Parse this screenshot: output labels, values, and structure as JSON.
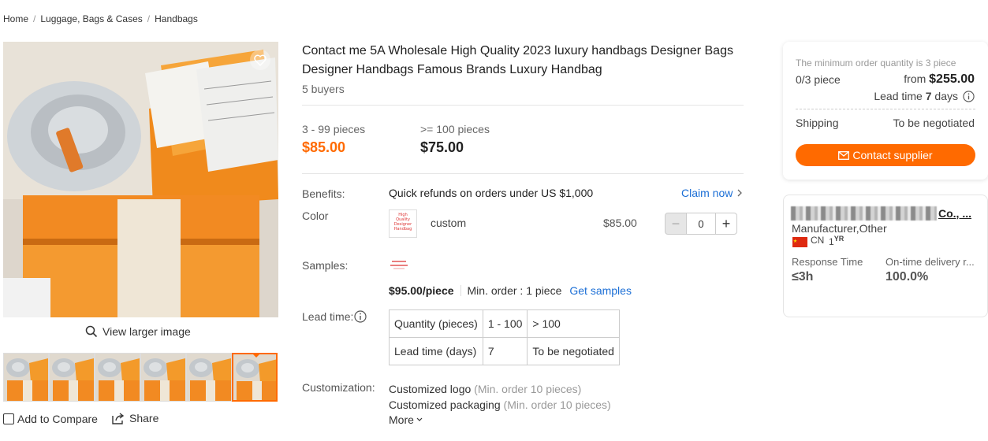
{
  "breadcrumb": {
    "items": [
      "Home",
      "Luggage, Bags & Cases",
      "Handbags"
    ],
    "separator": "/"
  },
  "gallery": {
    "view_larger": "View larger image",
    "thumb_count": 6,
    "active_thumb": 6,
    "add_to_compare": "Add to Compare",
    "share": "Share"
  },
  "product": {
    "title": "Contact me 5A Wholesale High Quality 2023 luxury handbags Designer Bags Designer Handbags Famous Brands Luxury Handbag",
    "buyers": "5 buyers",
    "tiers": [
      {
        "range": "3 - 99 pieces",
        "price": "$85.00"
      },
      {
        "range": ">= 100 pieces",
        "price": "$75.00"
      }
    ]
  },
  "benefits": {
    "label": "Benefits:",
    "text": "Quick refunds on orders under US $1,000",
    "claim": "Claim now"
  },
  "color": {
    "label": "Color",
    "name": "custom",
    "price": "$85.00",
    "qty": "0",
    "swatch_text": "High Quality Designer Handbag"
  },
  "samples": {
    "label": "Samples:",
    "price": "$95.00/piece",
    "min_order": "Min. order : 1 piece",
    "link": "Get samples"
  },
  "lead_time": {
    "label": "Lead time:",
    "rows": [
      [
        "Quantity (pieces)",
        "1 - 100",
        "> 100"
      ],
      [
        "Lead time (days)",
        "7",
        "To be negotiated"
      ]
    ]
  },
  "customization": {
    "label": "Customization:",
    "items": [
      {
        "name": "Customized logo",
        "note": "(Min. order 10 pieces)"
      },
      {
        "name": "Customized packaging",
        "note": "(Min. order 10 pieces)"
      }
    ],
    "more": "More"
  },
  "order_card": {
    "moq_note": "The minimum order quantity is 3 piece",
    "qty": "0/3 piece",
    "from_label": "from",
    "from_price": "$255.00",
    "lead_prefix": "Lead time",
    "lead_days": "7",
    "lead_suffix": "days",
    "shipping_label": "Shipping",
    "shipping_value": "To be negotiated",
    "contact": "Contact supplier"
  },
  "supplier": {
    "name_suffix": "Co., ...",
    "type": "Manufacturer,Other",
    "country": "CN",
    "years": "1",
    "years_unit": "YR",
    "stats": [
      {
        "label": "Response Time",
        "value": "≤3h"
      },
      {
        "label": "On-time delivery r...",
        "value": "100.0%"
      }
    ]
  },
  "colors": {
    "accent": "#ff6a00",
    "link": "#1c6fd6"
  },
  "icons": [
    "heart-icon",
    "magnifier-icon",
    "share-icon",
    "chevron-right-icon",
    "info-icon",
    "mail-icon",
    "chevron-down-icon",
    "flag-cn-icon"
  ]
}
